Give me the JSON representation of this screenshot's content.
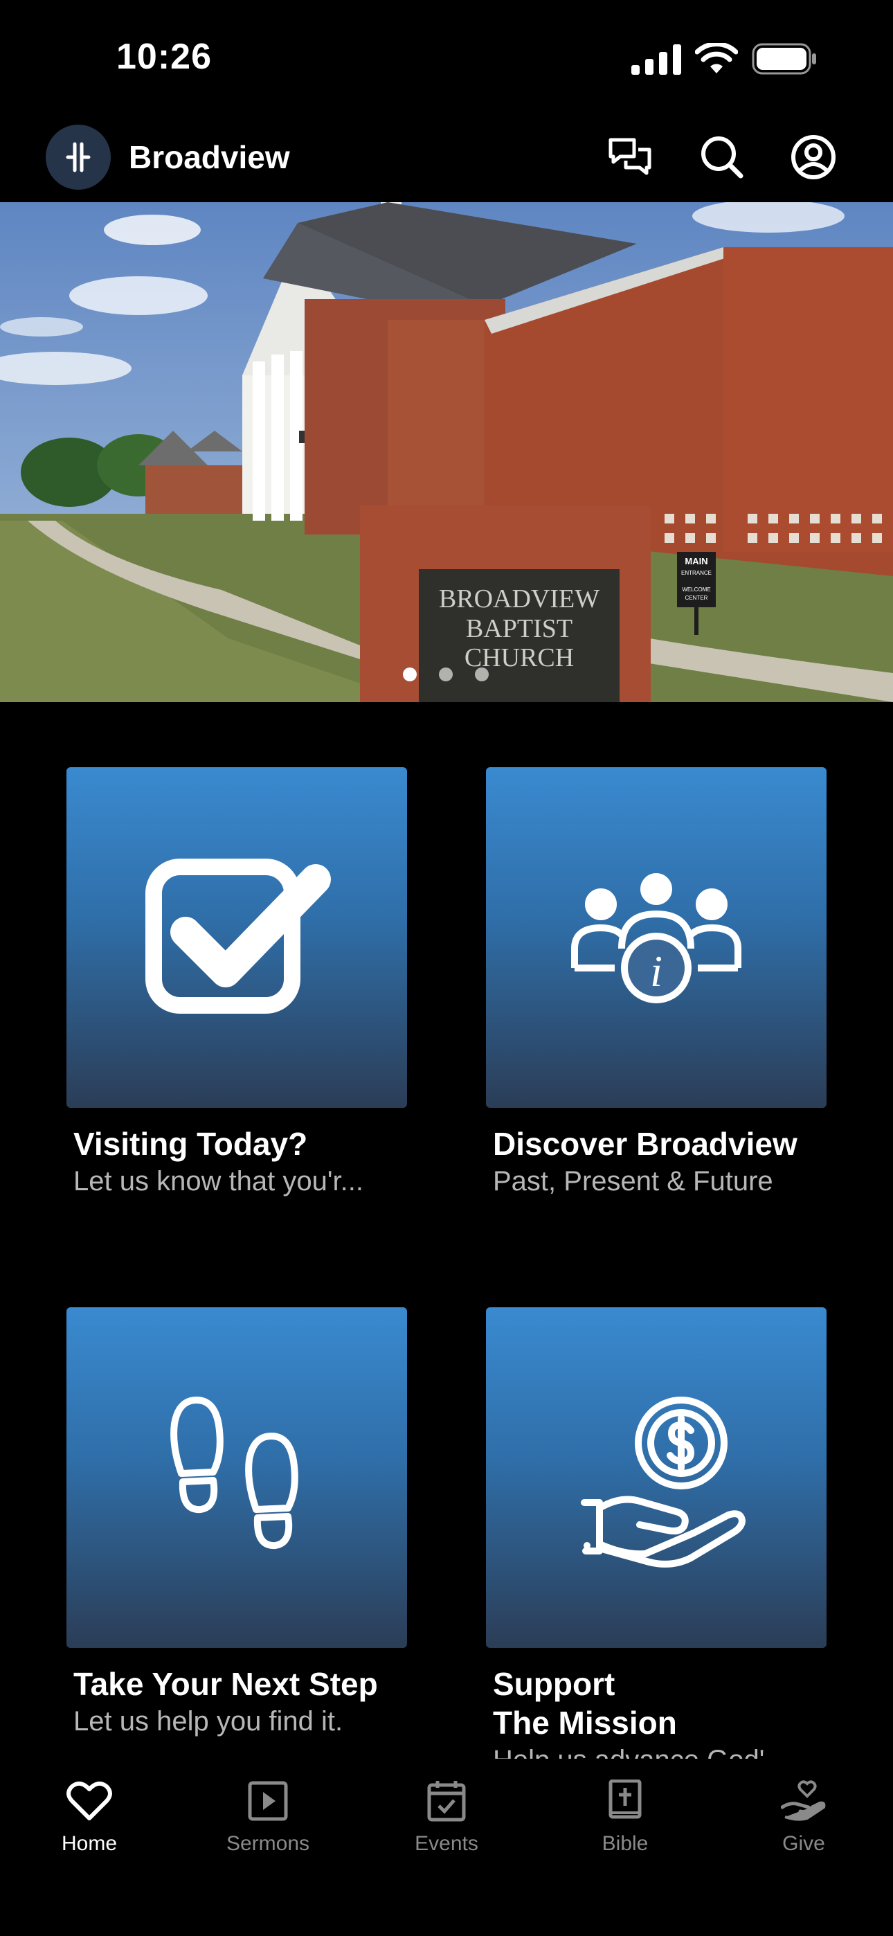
{
  "status_bar": {
    "time": "10:26"
  },
  "header": {
    "title": "Broadview"
  },
  "hero": {
    "sign_lines": [
      "BROADVIEW",
      "BAPTIST",
      "CHURCH"
    ],
    "entrance_sign": [
      "MAIN",
      "ENTRANCE",
      "WELCOME",
      "CENTER"
    ],
    "active_slide": 1,
    "slide_count": 3
  },
  "tiles": [
    {
      "title": "Visiting Today?",
      "subtitle": "Let us know that you'r..."
    },
    {
      "title": "Discover Broadview",
      "subtitle": "Past, Present & Future"
    },
    {
      "title": "Take Your Next Step",
      "subtitle": "Let us help you find it."
    },
    {
      "title_line1": "Support",
      "title_line2": "The Mission",
      "subtitle": "Help us advance God'"
    }
  ],
  "tabs": [
    {
      "label": "Home",
      "icon": "heart-icon",
      "active": true
    },
    {
      "label": "Sermons",
      "icon": "play-icon",
      "active": false
    },
    {
      "label": "Events",
      "icon": "calendar-icon",
      "active": false
    },
    {
      "label": "Bible",
      "icon": "bible-icon",
      "active": false
    },
    {
      "label": "Give",
      "icon": "give-icon",
      "active": false
    }
  ],
  "colors": {
    "background": "#000000",
    "tile_top": "#3a8ad0",
    "tile_bottom": "#2b3d56",
    "tab_inactive": "#8a8a8a",
    "tab_active": "#ffffff"
  }
}
